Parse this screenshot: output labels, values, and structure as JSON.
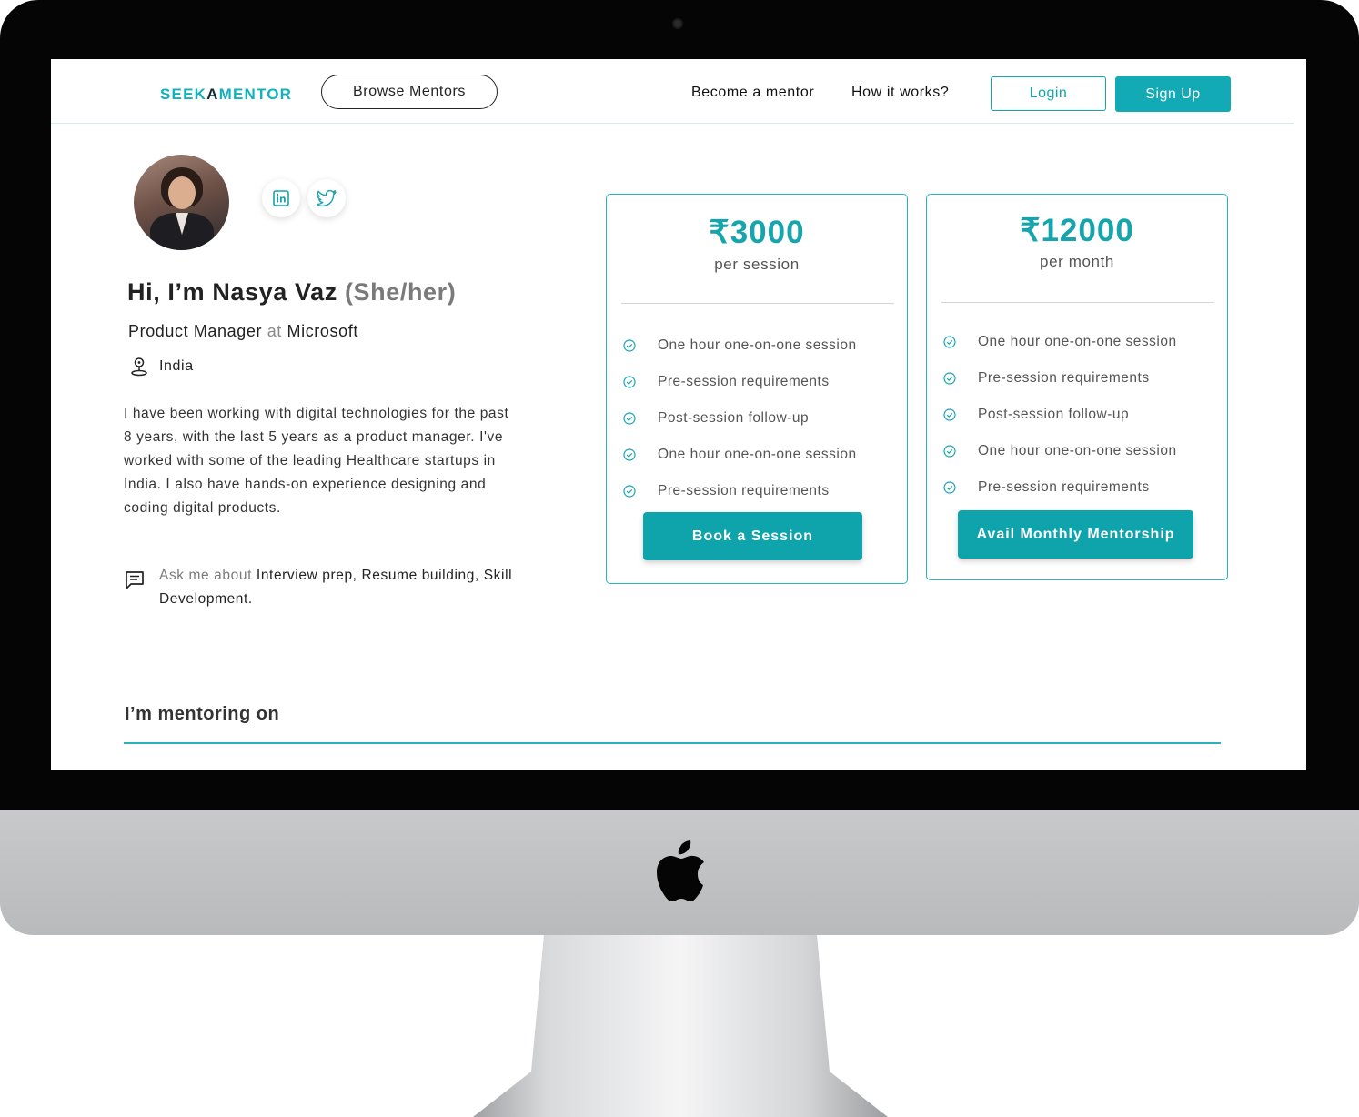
{
  "header": {
    "logo": {
      "part1": "SEEK",
      "part2": "A",
      "part3": "MENTOR"
    },
    "browse_label": "Browse Mentors",
    "nav": {
      "become_mentor": "Become a mentor",
      "how_it_works": "How it works?"
    },
    "login_label": "Login",
    "signup_label": "Sign Up"
  },
  "profile": {
    "greeting": "Hi, I’m Nasya Vaz",
    "pronouns": "(She/her)",
    "role": "Product Manager",
    "at": "at",
    "company": "Microsoft",
    "location": "India",
    "bio": "I have been working with digital technologies for the past 8 years, with the last 5 years as a product manager. I've worked with some of the leading Healthcare startups in India. I also have hands-on experience designing and coding digital products.",
    "ask_label": "Ask me about",
    "ask_topics": "Interview prep, Resume building, Skill Development."
  },
  "plans": {
    "session": {
      "price": "₹3000",
      "period": "per session",
      "features": [
        "One hour one-on-one session",
        "Pre-session requirements",
        "Post-session follow-up",
        "One hour one-on-one session",
        "Pre-session requirements"
      ],
      "cta": "Book a Session"
    },
    "monthly": {
      "price": "₹12000",
      "period": "per month",
      "features": [
        "One hour one-on-one session",
        "Pre-session requirements",
        "Post-session follow-up",
        "One hour one-on-one session",
        "Pre-session requirements"
      ],
      "cta": "Avail Monthly Mentorship"
    }
  },
  "mentoring": {
    "heading": "I’m mentoring on"
  },
  "colors": {
    "accent": "#11aab5",
    "text": "#222222",
    "muted": "#7a7a7a"
  },
  "icons": [
    "linkedin-icon",
    "twitter-icon",
    "location-pin-icon",
    "chat-icon",
    "check-circle-icon",
    "apple-logo-icon",
    "camera-icon"
  ]
}
